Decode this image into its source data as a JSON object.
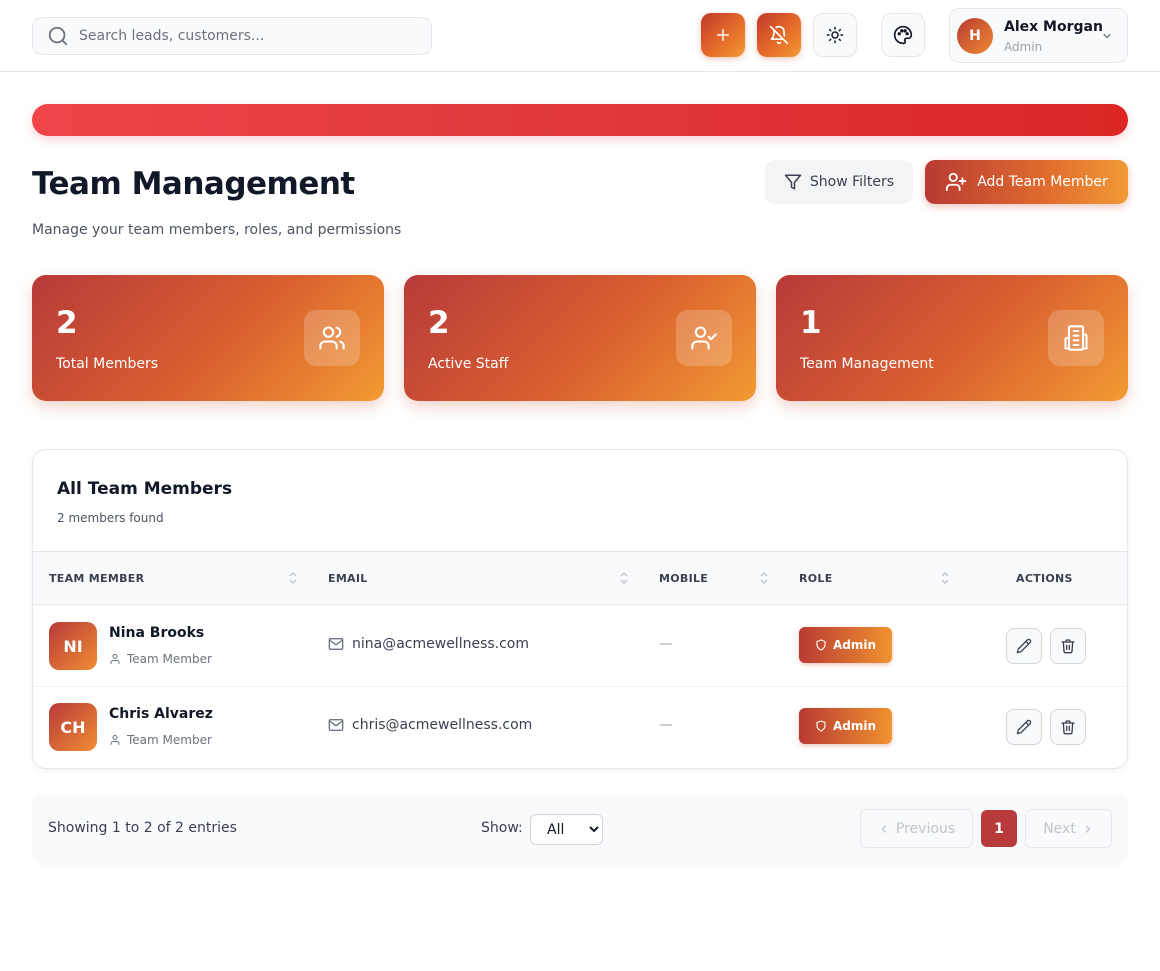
{
  "header": {
    "search_placeholder": "Search leads, customers...",
    "user": {
      "initial": "H",
      "name": "Alex Morgan",
      "role": "Admin"
    }
  },
  "page": {
    "title": "Team Management",
    "subtitle": "Manage your team members, roles, and permissions",
    "show_filters_label": "Show Filters",
    "add_member_label": "Add Team Member"
  },
  "stats": [
    {
      "value": "2",
      "label": "Total Members",
      "icon": "users-icon"
    },
    {
      "value": "2",
      "label": "Active Staff",
      "icon": "user-check-icon"
    },
    {
      "value": "1",
      "label": "Team Management",
      "icon": "building-icon"
    }
  ],
  "table": {
    "title": "All Team Members",
    "count_text": "2 members found",
    "columns": [
      "TEAM MEMBER",
      "EMAIL",
      "MOBILE",
      "ROLE",
      "ACTIONS"
    ],
    "rows": [
      {
        "initials": "NI",
        "name": "Nina Brooks",
        "type": "Team Member",
        "email": "nina@acmewellness.com",
        "mobile": "—",
        "role": "Admin"
      },
      {
        "initials": "CH",
        "name": "Chris Alvarez",
        "type": "Team Member",
        "email": "chris@acmewellness.com",
        "mobile": "—",
        "role": "Admin"
      }
    ]
  },
  "pagination": {
    "showing_text": "Showing 1 to 2 of 2 entries",
    "show_label": "Show:",
    "show_value": "All",
    "previous_label": "Previous",
    "current_page": "1",
    "next_label": "Next"
  },
  "colors": {
    "accent_start": "#b83a3a",
    "accent_end": "#f29a33",
    "banner": "#dc2626"
  }
}
